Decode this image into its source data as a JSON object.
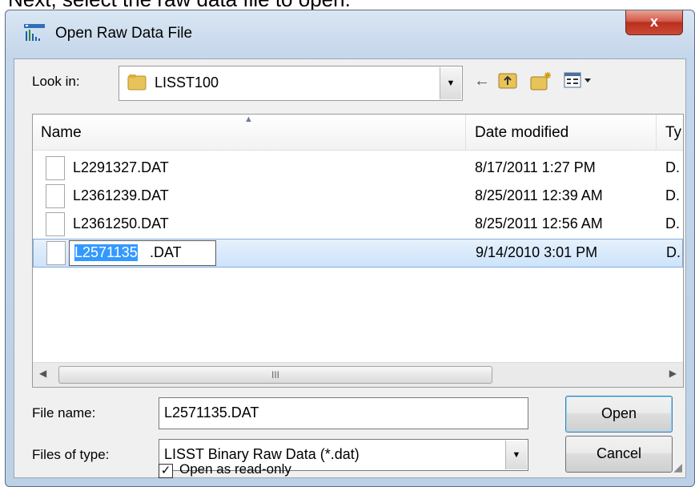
{
  "caption": "Next, select the raw data file to open.",
  "dialog": {
    "title": "Open Raw Data File",
    "close_label": "x"
  },
  "lookin": {
    "label": "Look in:",
    "value": "LISST100"
  },
  "columns": {
    "name": "Name",
    "date_modified": "Date modified",
    "type": "Ty"
  },
  "files": [
    {
      "name": "L2291327.DAT",
      "date": "8/17/2011 1:27 PM",
      "type": "D."
    },
    {
      "name": "L2361239.DAT",
      "date": "8/25/2011 12:39 AM",
      "type": "D."
    },
    {
      "name": "L2361250.DAT",
      "date": "8/25/2011 12:56 AM",
      "type": "D."
    },
    {
      "name": "L2571135.DAT",
      "date": "9/14/2010 3:01 PM",
      "type": "D."
    }
  ],
  "rename": {
    "selected": "L2571135",
    "rest": ".DAT"
  },
  "scrollbar": {
    "thumb_label": "III"
  },
  "file_name": {
    "label": "File name:",
    "value": "L2571135.DAT"
  },
  "file_type": {
    "label": "Files of type:",
    "value": "LISST Binary Raw Data (*.dat)"
  },
  "buttons": {
    "open": "Open",
    "cancel": "Cancel"
  },
  "readonly": {
    "label": "Open as read-only",
    "checked": true
  }
}
